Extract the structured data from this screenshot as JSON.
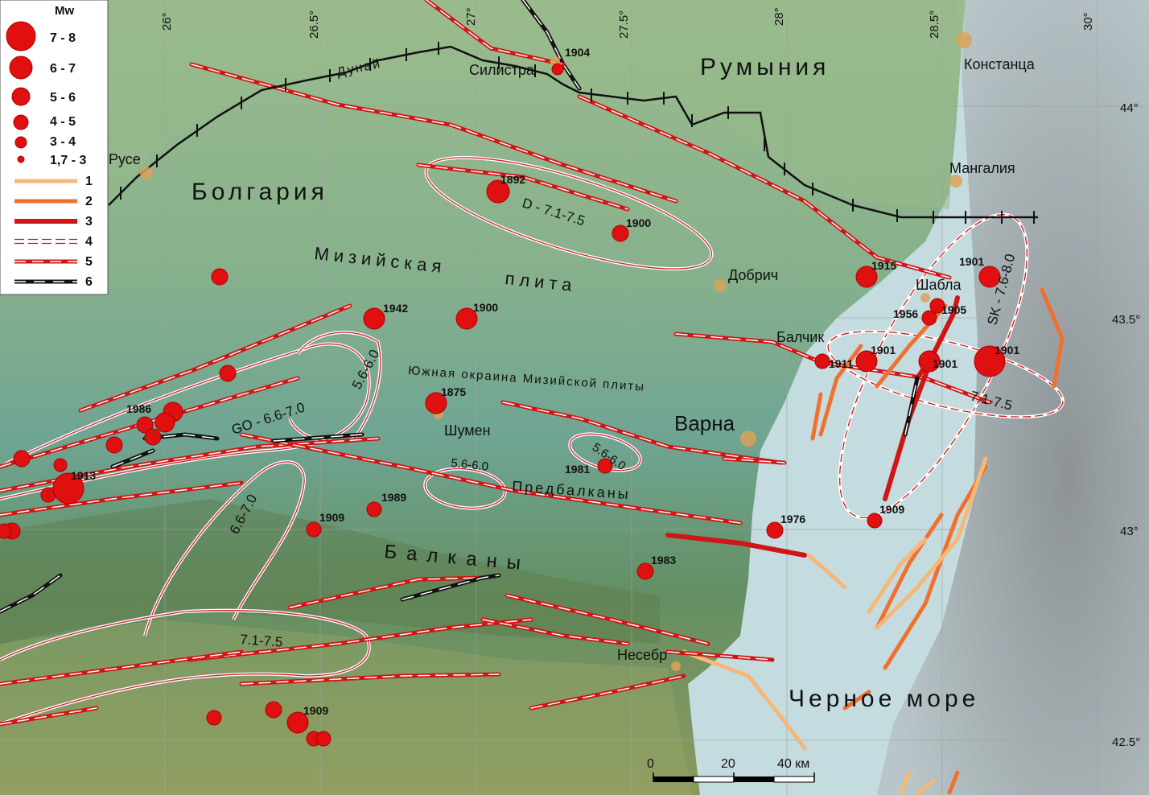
{
  "colors": {
    "sea": "#bcd9dd",
    "land_low": "#8fb48c",
    "land_mid": "#73a98f",
    "land_high": "#5f8f6a",
    "mountain": "#8a8a58",
    "deep_sea": "#9fa6a9",
    "quake": "#e01010",
    "fault1": "#f6b878",
    "fault2": "#f07030",
    "fault3": "#d01515",
    "fault_dash": "#ffffff",
    "border": "#111111",
    "city_marker": "#d9a25a"
  },
  "legend": {
    "mw_title": "Mw",
    "magnitude_classes": [
      "7 - 8",
      "6 - 7",
      "5 - 6",
      "4 - 5",
      "3 - 4",
      "1,7 - 3"
    ],
    "fault_classes": [
      "1",
      "2",
      "3",
      "4",
      "5",
      "6"
    ]
  },
  "coordinates": {
    "top": [
      "26°",
      "26.5°",
      "27°",
      "27.5°",
      "28°",
      "28.5°",
      "30°"
    ],
    "right": [
      "44°",
      "43.5°",
      "43°",
      "42.5°"
    ]
  },
  "regions": {
    "romania": "Румыния",
    "bulgaria": "Болгария",
    "moesian_plate_1": "Мизийская",
    "moesian_plate_2": "плита",
    "moesian_south": "Южная окраина Мизийской плиты",
    "predbalkans": "Предбалканы",
    "balkans": "Балканы",
    "black_sea": "Черное море",
    "danube": "Дунай"
  },
  "cities": {
    "ruse": "Русе",
    "silistra": "Силистра",
    "constanta": "Констанца",
    "mangalia": "Мангалия",
    "dobrich": "Добрич",
    "shabla": "Шабла",
    "balchik": "Балчик",
    "varna": "Варна",
    "shumen": "Шумен",
    "nesebar": "Несебр"
  },
  "zones": {
    "d": "D - 7.1-7.5",
    "go": "GO - 6.6-7.0",
    "sk": "SK - 7.6-8.0",
    "z1": "5.6-6.0",
    "z2": "5.6-6.0",
    "z3": "5.6-6.0",
    "z4": "6.6-7.0",
    "z5": "7.1-7.5",
    "z6": "7.1-7.5"
  },
  "earthquakes": {
    "y1904": "1904",
    "y1892": "1892",
    "y1900a": "1900",
    "y1915": "1915",
    "y1901a": "1901",
    "y1956": "1956",
    "y1905": "1905",
    "y1942": "1942",
    "y1900b": "1900",
    "y1911": "1911",
    "y1901b": "1901",
    "y1901c": "1901",
    "y1901d": "1901",
    "y1875": "1875",
    "y1986": "1986",
    "y1913": "1913",
    "y1981": "1981",
    "y1989": "1989",
    "y1909a": "1909",
    "y1976": "1976",
    "y1909b": "1909",
    "y1983": "1983",
    "y1909c": "1909"
  },
  "scale": {
    "ticks": [
      "0",
      "20",
      "40 км"
    ]
  }
}
